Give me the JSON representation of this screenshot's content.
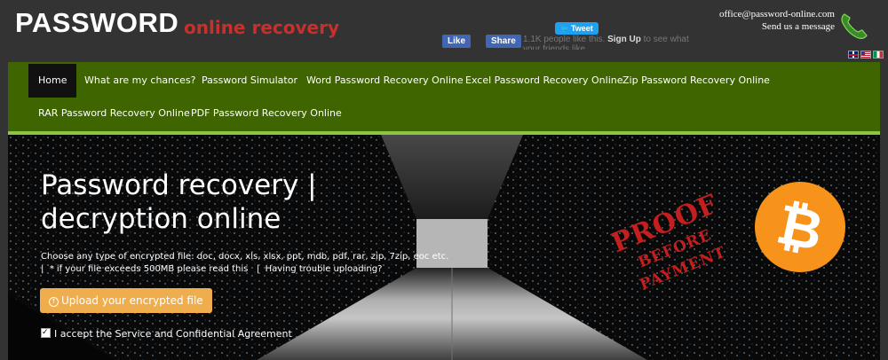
{
  "header": {
    "logo": "PASSWORD",
    "logo_sub": "online recovery",
    "tweet_label": "Tweet",
    "fb_like_label": "Like",
    "fb_share_label": "Share",
    "fb_count_text": "1.1K people like this.",
    "fb_signup_label": "Sign Up",
    "fb_signup_suffix": "to see what your friends like.",
    "email": "office@password-online.com",
    "send_message": "Send us a message",
    "icons": [
      "phone-icon",
      "flag-uk-icon",
      "flag-us-icon",
      "flag-it-icon"
    ]
  },
  "nav": {
    "items": [
      {
        "label": "Home",
        "active": true
      },
      {
        "label": "What are my chances?"
      },
      {
        "label": "Password Simulator"
      },
      {
        "label": "Word Password Recovery Online"
      },
      {
        "label": "Excel Password Recovery Online"
      },
      {
        "label": "Zip Password Recovery Online"
      },
      {
        "label": "RAR Password Recovery Online"
      },
      {
        "label": "PDF Password Recovery Online"
      }
    ]
  },
  "hero": {
    "title_line1": "Password recovery |",
    "title_line2": "decryption online",
    "desc_line1": "Choose any type of encrypted file: doc, docx, xls, xlsx, ppt, mdb, pdf, rar, zip, 7zip, eoc etc.",
    "desc_line2": "|  * if your file exceeds 500MB please read this   |  Having trouble uploading?",
    "upload_button": "Upload your encrypted file",
    "agreement": "I accept the Service and Confidential Agreement",
    "agreement_checked": true,
    "stamp_text": {
      "line1": "PROOF",
      "line2": "BEFORE",
      "line3": "PAYMENT"
    },
    "bitcoin_symbol": "₿"
  },
  "colors": {
    "background": "#333333",
    "nav_green": "#3e6500",
    "nav_accent": "#8cc640",
    "logo_sub_red": "#c9302c",
    "upload_orange": "#f0ad4e",
    "bitcoin_orange": "#f7931a",
    "stamp_red": "#c41e1e"
  }
}
